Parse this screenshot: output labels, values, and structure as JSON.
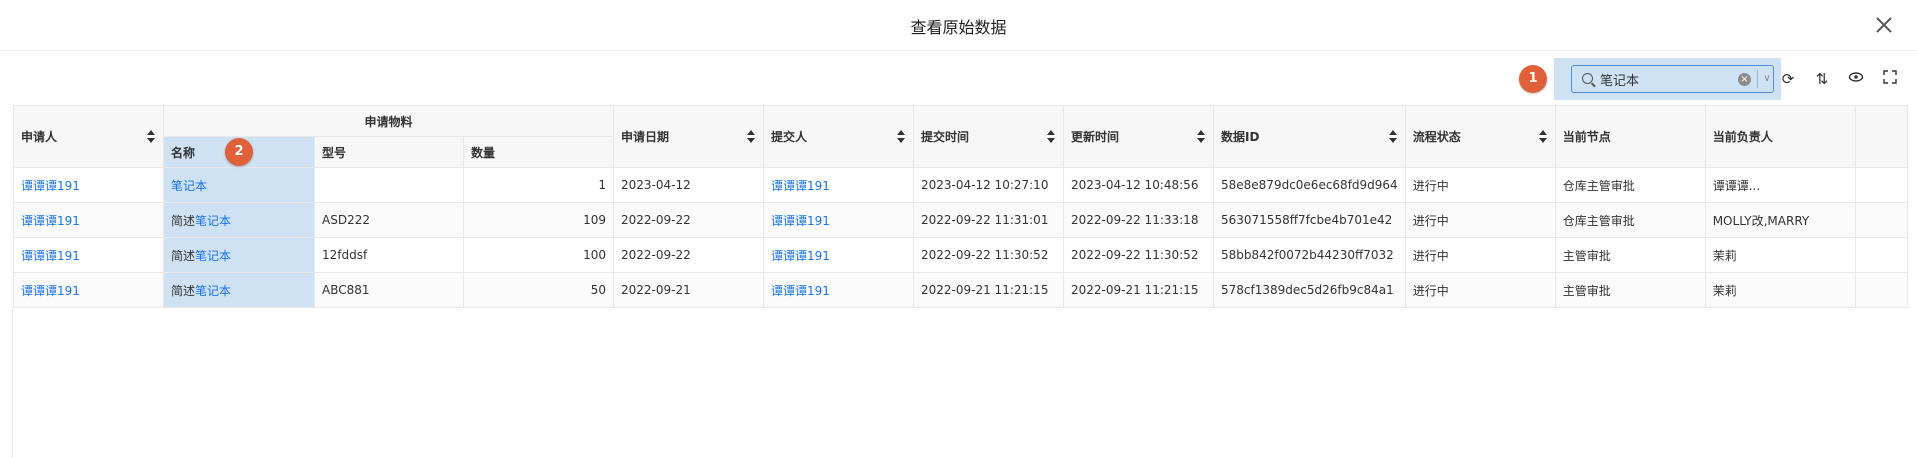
{
  "dialog": {
    "title": "查看原始数据",
    "close_icon": "close-icon"
  },
  "markers": [
    "1",
    "2"
  ],
  "search": {
    "value": "笔记本"
  },
  "toolbar": {
    "icons": [
      "refresh-icon",
      "sort-icon",
      "eye-icon",
      "fullscreen-icon"
    ]
  },
  "table": {
    "group_header": "申请物料",
    "headers": {
      "applicant": "申请人",
      "name": "名称",
      "model": "型号",
      "qty": "数量",
      "apply_date": "申请日期",
      "submitter": "提交人",
      "submit_time": "提交时间",
      "update_time": "更新时间",
      "data_id": "数据ID",
      "status": "流程状态",
      "node": "当前节点",
      "owner": "当前负责人"
    },
    "rows": [
      {
        "applicant": "谭谭谭191",
        "name_prefix": "",
        "name_hit": "笔记本",
        "model": "",
        "qty": "1",
        "apply_date": "2023-04-12",
        "submitter": "谭谭谭191",
        "submit_time": "2023-04-12 10:27:10",
        "update_time": "2023-04-12 10:48:56",
        "data_id": "58e8e879dc0e6ec68fd9d964",
        "status": "进行中",
        "node": "仓库主管审批",
        "owner": "谭谭谭..."
      },
      {
        "applicant": "谭谭谭191",
        "name_prefix": "简述",
        "name_hit": "笔记本",
        "model": "ASD222",
        "qty": "109",
        "apply_date": "2022-09-22",
        "submitter": "谭谭谭191",
        "submit_time": "2022-09-22 11:31:01",
        "update_time": "2022-09-22 11:33:18",
        "data_id": "563071558ff7fcbe4b701e42",
        "status": "进行中",
        "node": "仓库主管审批",
        "owner": "MOLLY改,MARRY"
      },
      {
        "applicant": "谭谭谭191",
        "name_prefix": "简述",
        "name_hit": "笔记本",
        "model": "12fddsf",
        "qty": "100",
        "apply_date": "2022-09-22",
        "submitter": "谭谭谭191",
        "submit_time": "2022-09-22 11:30:52",
        "update_time": "2022-09-22 11:30:52",
        "data_id": "58bb842f0072b44230ff7032",
        "status": "进行中",
        "node": "主管审批",
        "owner": "茉莉"
      },
      {
        "applicant": "谭谭谭191",
        "name_prefix": "简述",
        "name_hit": "笔记本",
        "model": "ABC881",
        "qty": "50",
        "apply_date": "2022-09-21",
        "submitter": "谭谭谭191",
        "submit_time": "2022-09-21 11:21:15",
        "update_time": "2022-09-21 11:21:15",
        "data_id": "578cf1389dec5d26fb9c84a1",
        "status": "进行中",
        "node": "主管审批",
        "owner": "茉莉"
      }
    ]
  }
}
